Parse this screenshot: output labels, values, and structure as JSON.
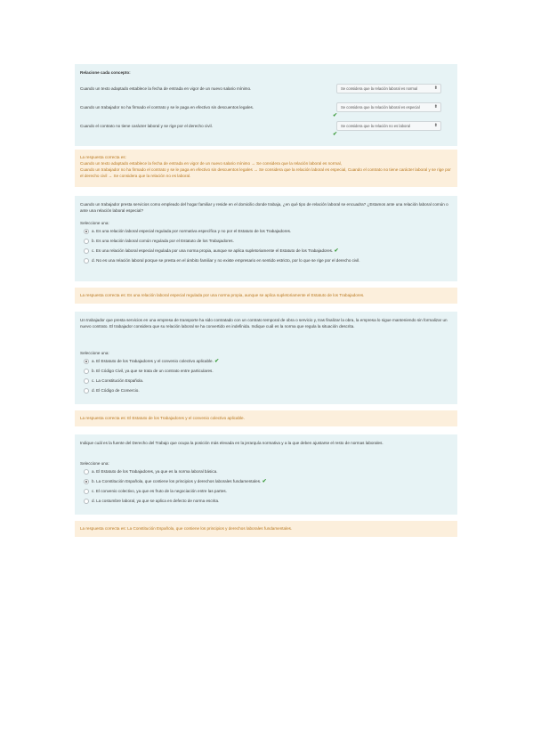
{
  "q1": {
    "title": "Relacione cada concepto:",
    "rows": [
      {
        "label": "Cuando un texto adaptado establece la fecha de entrada en vigor de un nuevo salario mínimo.",
        "value": "Se considera que la relación laboral es normal",
        "correct": false
      },
      {
        "label": "Cuando un trabajador no ha firmado el contrato y se le paga en efectivo sin descuentos legales.",
        "value": "Se considera que la relación laboral es especial",
        "correct": true
      },
      {
        "label": "Cuando el contrato no tiene carácter laboral y se rige por el derecho civil.",
        "value": "Se considera que la relación no es laboral",
        "correct": true
      }
    ],
    "feedback": {
      "heading": "La respuesta correcta es:",
      "lines": [
        "Cuando un texto adaptado establece la fecha de entrada en vigor de un nuevo salario mínimo → Se considera que la relación laboral es normal,",
        "Cuando un trabajador no ha firmado el contrato y se le paga en efectivo sin descuentos legales → Se considera que la relación laboral es especial, Cuando el contrato no tiene carácter laboral y se rige por el derecho civil → Se considera que la relación no es laboral."
      ]
    }
  },
  "q2": {
    "prompt": "Cuando un trabajador presta servicios como empleado del hogar familiar y reside en el domicilio donde trabaja, ¿en qué tipo de relación laboral se encuadra? ¿Estamos ante una relación laboral común o ante una relación laboral especial?",
    "select_label": "Seleccione una:",
    "options": [
      {
        "letter": "a.",
        "text": "Es una relación laboral especial regulada por normativa específica y no por el Estatuto de los Trabajadores.",
        "checked": true,
        "correct": false
      },
      {
        "letter": "b.",
        "text": "Es una relación laboral común regulada por el Estatuto de los Trabajadores.",
        "checked": false,
        "correct": false
      },
      {
        "letter": "c.",
        "text": "Es una relación laboral especial regulada por una norma propia, aunque se aplica supletoriamente el Estatuto de los Trabajadores.",
        "checked": false,
        "correct": true
      },
      {
        "letter": "d.",
        "text": "No es una relación laboral porque se presta en el ámbito familiar y no existe empresario en sentido estricto, por lo que se rige por el derecho civil.",
        "checked": false,
        "correct": false
      }
    ],
    "feedback": "La respuesta correcta es: Es una relación laboral especial regulada por una norma propia, aunque se aplica supletoriamente el Estatuto de los Trabajadores."
  },
  "q3": {
    "prompt": "Un trabajador que presta servicios en una empresa de transporte ha sido contratado con un contrato temporal de obra o servicio y, tras finalizar la obra, la empresa lo sigue manteniendo sin formalizar un nuevo contrato. El trabajador considera que su relación laboral se ha convertido en indefinida. Indique cuál es la norma que regula la situación descrita.",
    "select_label": "Seleccione una:",
    "options": [
      {
        "letter": "a.",
        "text": "El Estatuto de los Trabajadores y el convenio colectivo aplicable.",
        "checked": true,
        "correct": true
      },
      {
        "letter": "b.",
        "text": "El Código Civil, ya que se trata de un contrato entre particulares.",
        "checked": false,
        "correct": false
      },
      {
        "letter": "c.",
        "text": "La Constitución Española.",
        "checked": false,
        "correct": false
      },
      {
        "letter": "d.",
        "text": "El Código de Comercio.",
        "checked": false,
        "correct": false
      }
    ],
    "feedback": "La respuesta correcta es: El Estatuto de los Trabajadores y el convenio colectivo aplicable."
  },
  "q4": {
    "prompt": "Indique cuál es la fuente del Derecho del Trabajo que ocupa la posición más elevada en la jerarquía normativa y a la que deben ajustarse el resto de normas laborales.",
    "select_label": "Seleccione una:",
    "options": [
      {
        "letter": "a.",
        "text": "El Estatuto de los Trabajadores, ya que es la norma laboral básica.",
        "checked": false,
        "correct": false
      },
      {
        "letter": "b.",
        "text": "La Constitución Española, que contiene los principios y derechos laborales fundamentales.",
        "checked": true,
        "correct": true
      },
      {
        "letter": "c.",
        "text": "El convenio colectivo, ya que es fruto de la negociación entre las partes.",
        "checked": false,
        "correct": false
      },
      {
        "letter": "d.",
        "text": "La costumbre laboral, ya que se aplica en defecto de norma escrita.",
        "checked": false,
        "correct": false
      }
    ],
    "feedback": "La respuesta correcta es: La Constitución Española, que contiene los principios y derechos laborales fundamentales."
  },
  "colors": {
    "question_bg": "#e7f3f5",
    "feedback_bg": "#fcefdc",
    "correct": "#3c9a3a",
    "feedback_text": "#b8781f"
  }
}
